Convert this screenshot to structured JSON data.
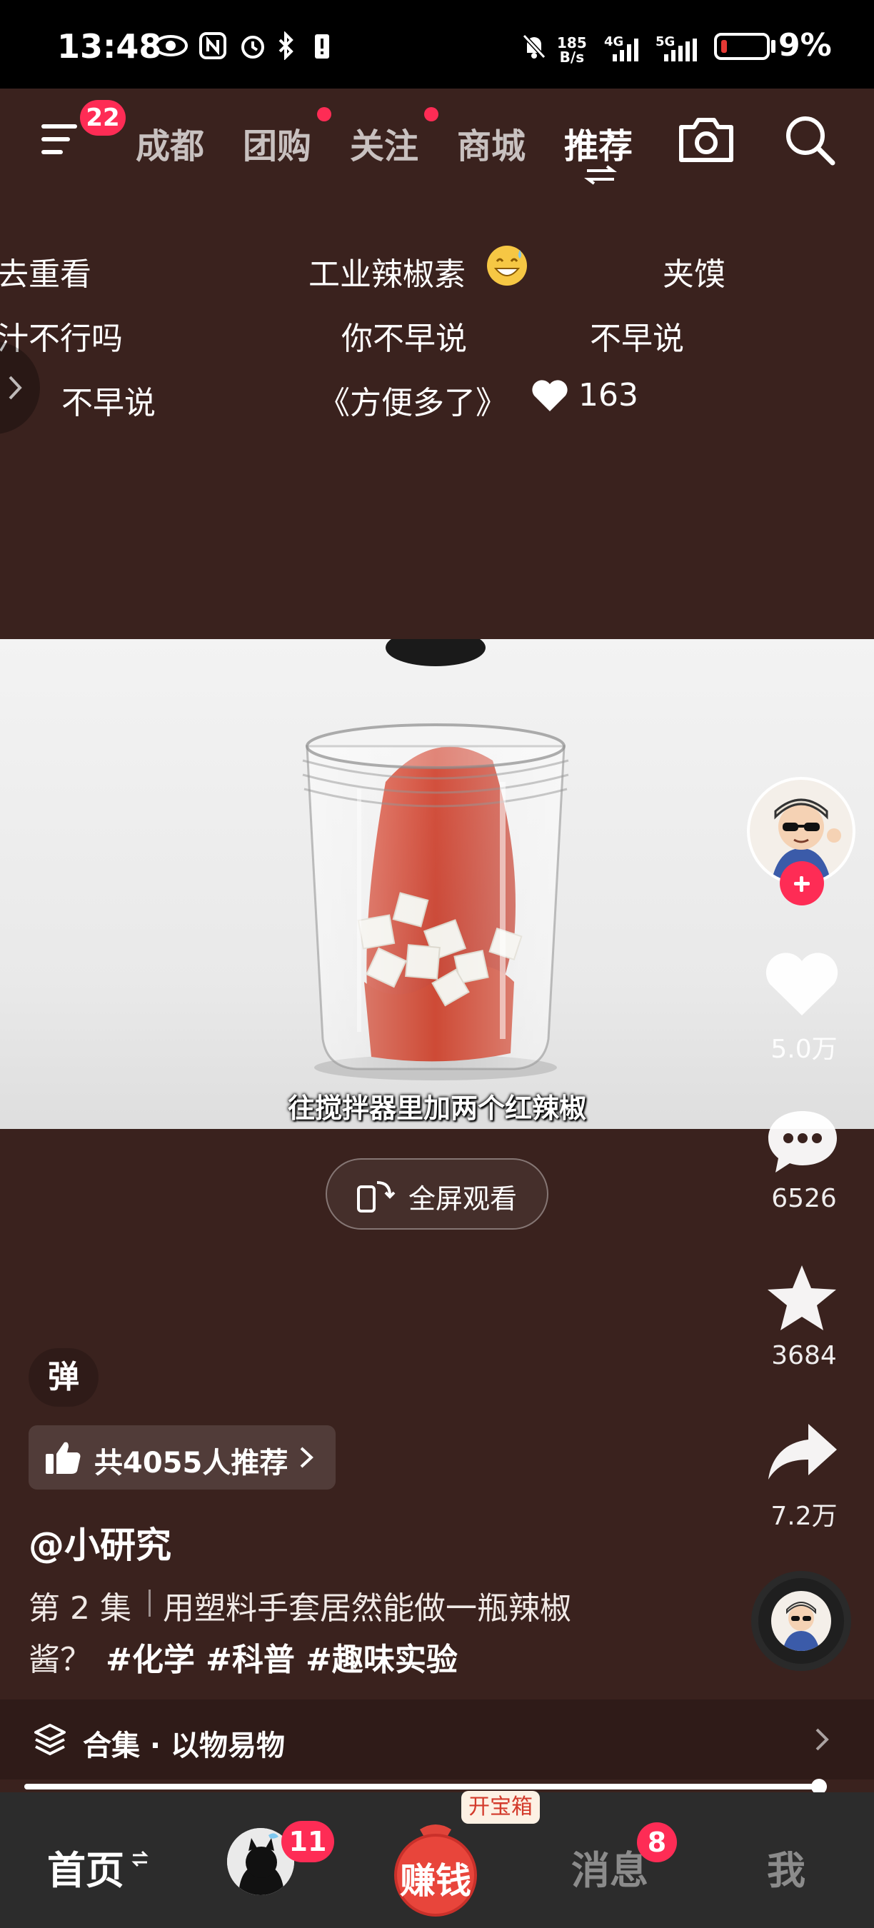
{
  "status_bar": {
    "time": "13:48",
    "net_speed_top": "185",
    "net_speed_bottom": "B/s",
    "net_4g": "4G",
    "net_5g": "5G",
    "battery": "9%"
  },
  "top_nav": {
    "menu_badge": "22",
    "tabs": [
      "成都",
      "团购",
      "关注",
      "商城",
      "推荐"
    ],
    "active_tab": "推荐",
    "icons": [
      "menu-icon",
      "camera-icon",
      "search-icon"
    ]
  },
  "danmaku": {
    "row1": [
      "去重看",
      "工业辣椒素",
      "夹馍"
    ],
    "row2": [
      "汁不行吗",
      "你不早说",
      "不早说"
    ],
    "row3": [
      "不早说",
      "《方便多了》"
    ],
    "like_count": "163"
  },
  "video": {
    "subtitle": "往搅拌器里加两个红辣椒",
    "fullscreen_label": "全屏观看"
  },
  "right_rail": {
    "likes": "5.0万",
    "comments": "6526",
    "favorites": "3684",
    "shares": "7.2万"
  },
  "post": {
    "danmaku_toggle": "弹",
    "recommend_label": "共4055人推荐",
    "author": "@小研究",
    "episode": "第 2 集",
    "title_line1": "用塑料手套居然能做一瓶辣椒",
    "title_line2": "酱？",
    "hashtags": [
      "#化学",
      "#科普",
      "#趣味实验"
    ],
    "collection": "合集 · 以物易物"
  },
  "progress": {
    "fraction": 0.99
  },
  "bottom_nav": {
    "home": "首页",
    "friends_badge": "11",
    "earn": "赚钱",
    "earn_tag": "开宝箱",
    "messages": "消息",
    "messages_badge": "8",
    "me": "我"
  },
  "colors": {
    "background": "#3a221e",
    "accent": "#fe2c55",
    "bottom_bar": "#2c2c2c"
  }
}
